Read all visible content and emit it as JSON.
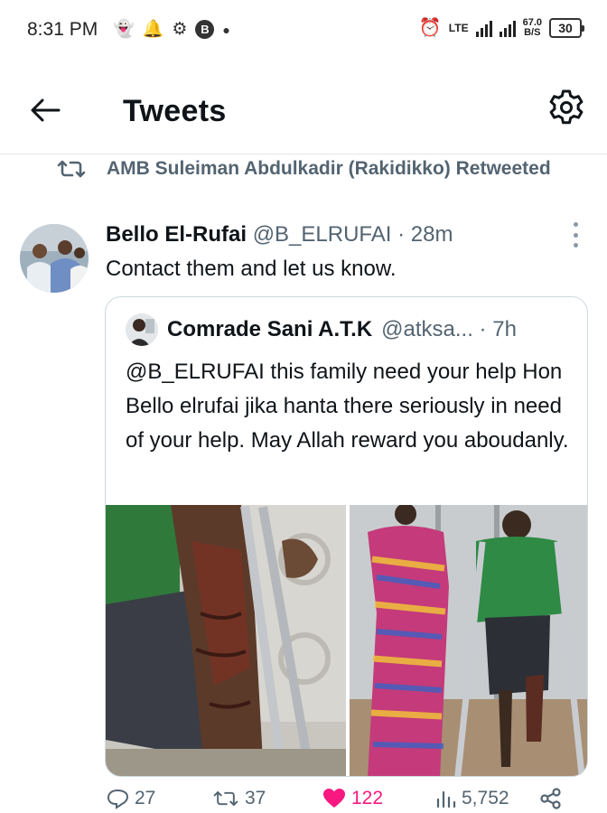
{
  "status_bar": {
    "time": "8:31 PM",
    "network": "LTE",
    "speed_value": "67.0",
    "speed_unit": "B/S",
    "battery": "30",
    "icons": [
      "snapchat-icon",
      "notification-bell-icon",
      "android-icon",
      "b-app-icon",
      "dot-icon",
      "alarm-icon",
      "signal-icon",
      "battery-icon"
    ]
  },
  "header": {
    "title": "Tweets",
    "back_icon": "arrow-left-icon",
    "settings_icon": "gear-icon"
  },
  "retweet_context": {
    "text": "AMB Suleiman Abdulkadir (Rakidikko) Retweeted",
    "icon": "retweet-icon"
  },
  "tweet": {
    "author_name": "Bello El-Rufai",
    "author_handle": "@B_ELRUFAI",
    "separator": " · ",
    "time": "28m",
    "text": "Contact them and let us know."
  },
  "quoted_tweet": {
    "author_name": "Comrade Sani A.T.K",
    "author_handle": "@atksa...",
    "separator": " · ",
    "time": "7h",
    "text": "@B_ELRUFAI this family need your help Hon Bello elrufai jika hanta there seriously in need of your help. May Allah reward you aboudanly.",
    "photos": [
      "photo-leg-wound",
      "photo-boy-on-crutches"
    ]
  },
  "actions": {
    "replies": "27",
    "retweets": "37",
    "likes": "122",
    "views": "5,752",
    "colors": {
      "muted": "#536471",
      "like": "#f91880"
    }
  }
}
